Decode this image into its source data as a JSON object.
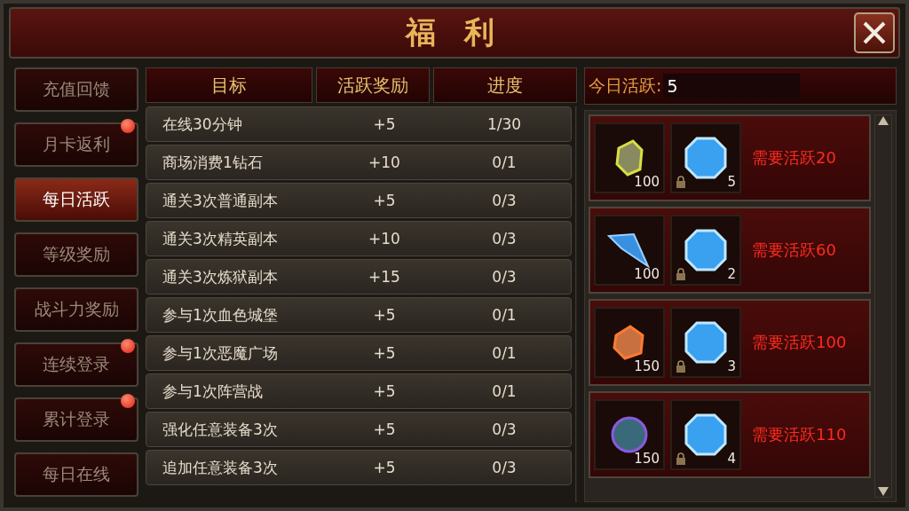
{
  "window": {
    "title": "福 利"
  },
  "sidebar": {
    "items": [
      {
        "label": "充值回馈",
        "selected": false,
        "badge": false
      },
      {
        "label": "月卡返利",
        "selected": false,
        "badge": true
      },
      {
        "label": "每日活跃",
        "selected": true,
        "badge": false
      },
      {
        "label": "等级奖励",
        "selected": false,
        "badge": false
      },
      {
        "label": "战斗力奖励",
        "selected": false,
        "badge": false
      },
      {
        "label": "连续登录",
        "selected": false,
        "badge": true
      },
      {
        "label": "累计登录",
        "selected": false,
        "badge": true
      },
      {
        "label": "每日在线",
        "selected": false,
        "badge": false
      }
    ]
  },
  "table": {
    "columns": [
      "目标",
      "活跃奖励",
      "进度"
    ],
    "rows": [
      [
        "在线30分钟",
        "+5",
        "1/30"
      ],
      [
        "商场消费1钻石",
        "+10",
        "0/1"
      ],
      [
        "通关3次普通副本",
        "+5",
        "0/3"
      ],
      [
        "通关3次精英副本",
        "+10",
        "0/3"
      ],
      [
        "通关3次炼狱副本",
        "+15",
        "0/3"
      ],
      [
        "参与1次血色城堡",
        "+5",
        "0/1"
      ],
      [
        "参与1次恶魔广场",
        "+5",
        "0/1"
      ],
      [
        "参与1次阵营战",
        "+5",
        "0/1"
      ],
      [
        "强化任意装备3次",
        "+5",
        "0/3"
      ],
      [
        "追加任意装备3次",
        "+5",
        "0/3"
      ]
    ]
  },
  "activity": {
    "label": "今日活跃:",
    "value": "5"
  },
  "rewards": [
    {
      "items": [
        {
          "kind": "rock",
          "count": "100",
          "locked": false
        },
        {
          "kind": "gem",
          "count": "5",
          "locked": true
        }
      ],
      "requirement": "需要活跃20"
    },
    {
      "items": [
        {
          "kind": "crystal",
          "count": "100",
          "locked": false
        },
        {
          "kind": "gem",
          "count": "2",
          "locked": true
        }
      ],
      "requirement": "需要活跃60"
    },
    {
      "items": [
        {
          "kind": "ore",
          "count": "150",
          "locked": false
        },
        {
          "kind": "gem",
          "count": "3",
          "locked": true
        }
      ],
      "requirement": "需要活跃100"
    },
    {
      "items": [
        {
          "kind": "orb",
          "count": "150",
          "locked": false
        },
        {
          "kind": "gem",
          "count": "4",
          "locked": true
        }
      ],
      "requirement": "需要活跃110"
    }
  ]
}
